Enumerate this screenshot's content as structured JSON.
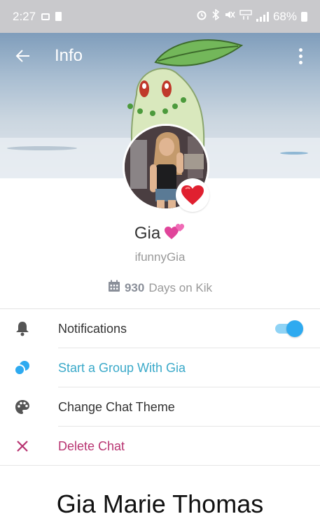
{
  "status_bar": {
    "time": "2:27",
    "battery": "68%",
    "icons": [
      "screen-icon",
      "card-icon",
      "alarm-icon",
      "bluetooth-icon",
      "mute-icon",
      "lte-icon",
      "signal-icon",
      "battery-icon"
    ]
  },
  "app_bar": {
    "title": "Info",
    "back_icon": "arrow-left-icon",
    "more_icon": "more-vertical-icon"
  },
  "profile": {
    "display_name": "Gia",
    "name_emoji": "💕",
    "username": "ifunnyGia",
    "days_count": "930",
    "days_suffix": "Days on Kik",
    "badge_emoji": "heart"
  },
  "menu": {
    "items": [
      {
        "label": "Notifications",
        "icon": "bell-icon",
        "toggle_on": true
      },
      {
        "label": "Start a Group With Gia",
        "icon": "group-icon"
      },
      {
        "label": "Change Chat Theme",
        "icon": "palette-icon"
      },
      {
        "label": "Delete Chat",
        "icon": "close-icon"
      }
    ]
  },
  "colors": {
    "accent_blue": "#2eaaf0",
    "link_blue": "#3aa9c9",
    "delete_red": "#b83471",
    "status_bar": "#c9c9cc"
  },
  "caption": "Gia Marie Thomas"
}
